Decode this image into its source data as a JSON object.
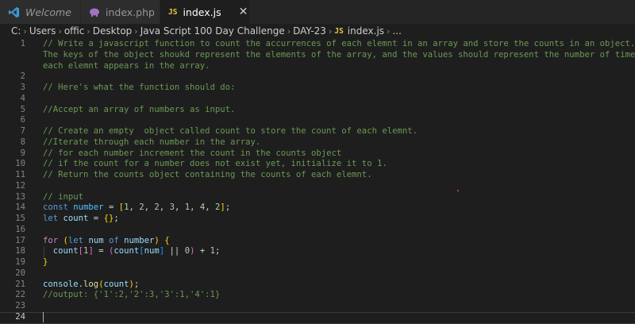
{
  "tabs": [
    {
      "label": "Welcome",
      "icon": "vscode-logo-icon",
      "active": false
    },
    {
      "label": "index.php",
      "icon": "php-elephant-icon",
      "active": false
    },
    {
      "label": "index.js",
      "icon": "js-file-icon",
      "icon_text": "JS",
      "active": true,
      "close": "✕"
    }
  ],
  "breadcrumb": {
    "items": [
      "C:",
      "Users",
      "offic",
      "Desktop",
      "Java Script 100 Day Challenge",
      "DAY-23"
    ],
    "file_badge": "JS",
    "file": "index.js",
    "trailing": "..."
  },
  "editor": {
    "current_line": 24,
    "lines": [
      {
        "n": "1",
        "tokens": [
          {
            "t": "comment",
            "v": "// Write a javascript function to count the accurrences of each elemnt in an array and store the counts in an object."
          }
        ]
      },
      {
        "n": "",
        "tokens": [
          {
            "t": "comment",
            "v": "The keys of the object shoukd represent the elements of the array, and the values should represent the number of times"
          }
        ]
      },
      {
        "n": "",
        "tokens": [
          {
            "t": "comment",
            "v": "each elemnt appears in the array."
          }
        ]
      },
      {
        "n": "2",
        "tokens": []
      },
      {
        "n": "3",
        "tokens": [
          {
            "t": "comment",
            "v": "// Here's what the function should do:"
          }
        ]
      },
      {
        "n": "4",
        "tokens": []
      },
      {
        "n": "5",
        "tokens": [
          {
            "t": "comment",
            "v": "//Accept an array of numbers as input."
          }
        ]
      },
      {
        "n": "6",
        "tokens": []
      },
      {
        "n": "7",
        "tokens": [
          {
            "t": "comment",
            "v": "// Create an empty  object called count to store the count of each elemnt."
          }
        ]
      },
      {
        "n": "8",
        "tokens": [
          {
            "t": "comment",
            "v": "//Iterate through each number in the array."
          }
        ]
      },
      {
        "n": "9",
        "tokens": [
          {
            "t": "comment",
            "v": "// for each number increment the count in the counts object"
          }
        ]
      },
      {
        "n": "10",
        "tokens": [
          {
            "t": "comment",
            "v": "// if the count for a number does not exist yet, initialize it to 1."
          }
        ]
      },
      {
        "n": "11",
        "tokens": [
          {
            "t": "comment",
            "v": "// Return the counts object containing the counts of each elemnt."
          }
        ]
      },
      {
        "n": "12",
        "tokens": []
      },
      {
        "n": "13",
        "tokens": [
          {
            "t": "comment",
            "v": "// input"
          }
        ]
      },
      {
        "n": "14",
        "tokens": [
          {
            "t": "keyword",
            "v": "const"
          },
          {
            "t": "op",
            "v": " "
          },
          {
            "t": "const",
            "v": "number"
          },
          {
            "t": "op",
            "v": " = "
          },
          {
            "t": "b1",
            "v": "["
          },
          {
            "t": "number",
            "v": "1"
          },
          {
            "t": "op",
            "v": ", "
          },
          {
            "t": "number",
            "v": "2"
          },
          {
            "t": "op",
            "v": ", "
          },
          {
            "t": "number",
            "v": "2"
          },
          {
            "t": "op",
            "v": ", "
          },
          {
            "t": "number",
            "v": "3"
          },
          {
            "t": "op",
            "v": ", "
          },
          {
            "t": "number",
            "v": "1"
          },
          {
            "t": "op",
            "v": ", "
          },
          {
            "t": "number",
            "v": "4"
          },
          {
            "t": "op",
            "v": ", "
          },
          {
            "t": "number",
            "v": "2"
          },
          {
            "t": "b1",
            "v": "]"
          },
          {
            "t": "op",
            "v": ";"
          }
        ]
      },
      {
        "n": "15",
        "tokens": [
          {
            "t": "keyword",
            "v": "let"
          },
          {
            "t": "op",
            "v": " "
          },
          {
            "t": "var",
            "v": "count"
          },
          {
            "t": "op",
            "v": " = "
          },
          {
            "t": "b1",
            "v": "{}"
          },
          {
            "t": "op",
            "v": ";"
          }
        ]
      },
      {
        "n": "16",
        "tokens": []
      },
      {
        "n": "17",
        "tokens": [
          {
            "t": "control",
            "v": "for"
          },
          {
            "t": "op",
            "v": " "
          },
          {
            "t": "b1",
            "v": "("
          },
          {
            "t": "keyword",
            "v": "let"
          },
          {
            "t": "op",
            "v": " "
          },
          {
            "t": "var",
            "v": "num"
          },
          {
            "t": "op",
            "v": " "
          },
          {
            "t": "keyword",
            "v": "of"
          },
          {
            "t": "op",
            "v": " "
          },
          {
            "t": "var",
            "v": "number"
          },
          {
            "t": "b1",
            "v": ")"
          },
          {
            "t": "op",
            "v": " "
          },
          {
            "t": "b1",
            "v": "{"
          }
        ]
      },
      {
        "n": "18",
        "tokens": [
          {
            "t": "op",
            "v": "  "
          },
          {
            "t": "var",
            "v": "count"
          },
          {
            "t": "b2",
            "v": "["
          },
          {
            "t": "number",
            "v": "1"
          },
          {
            "t": "b2",
            "v": "]"
          },
          {
            "t": "op",
            "v": " = "
          },
          {
            "t": "b2",
            "v": "("
          },
          {
            "t": "var",
            "v": "count"
          },
          {
            "t": "b3",
            "v": "["
          },
          {
            "t": "var",
            "v": "num"
          },
          {
            "t": "b3",
            "v": "]"
          },
          {
            "t": "op",
            "v": " || "
          },
          {
            "t": "number",
            "v": "0"
          },
          {
            "t": "b2",
            "v": ")"
          },
          {
            "t": "op",
            "v": " + "
          },
          {
            "t": "number",
            "v": "1"
          },
          {
            "t": "op",
            "v": ";"
          }
        ]
      },
      {
        "n": "19",
        "tokens": [
          {
            "t": "b1",
            "v": "}"
          }
        ]
      },
      {
        "n": "20",
        "tokens": []
      },
      {
        "n": "21",
        "tokens": [
          {
            "t": "var",
            "v": "console"
          },
          {
            "t": "op",
            "v": "."
          },
          {
            "t": "func",
            "v": "log"
          },
          {
            "t": "b1",
            "v": "("
          },
          {
            "t": "var",
            "v": "count"
          },
          {
            "t": "b1",
            "v": ")"
          },
          {
            "t": "op",
            "v": ";"
          }
        ]
      },
      {
        "n": "22",
        "tokens": [
          {
            "t": "comment",
            "v": "//output: {'1':2,'2':3,'3':1,'4':1}"
          }
        ]
      },
      {
        "n": "23",
        "tokens": []
      },
      {
        "n": "24",
        "tokens": []
      }
    ]
  },
  "colors": {
    "editor_bg": "#1e1e1e",
    "tabbar_bg": "#252526",
    "comment": "#6a9955",
    "keyword": "#569cd6",
    "js_badge": "#e8c547",
    "php_icon": "#a074c4",
    "vscode_blue": "#3c99d4"
  }
}
